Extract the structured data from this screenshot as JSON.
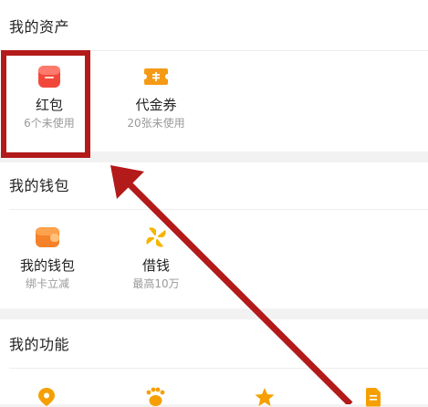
{
  "assets": {
    "title": "我的资产",
    "items": [
      {
        "icon": "red-packet-icon",
        "label": "红包",
        "sub": "6个未使用"
      },
      {
        "icon": "voucher-icon",
        "label": "代金券",
        "sub": "20张未使用"
      }
    ]
  },
  "wallet": {
    "title": "我的钱包",
    "items": [
      {
        "icon": "wallet-icon",
        "label": "我的钱包",
        "sub": "绑卡立减"
      },
      {
        "icon": "pinwheel-icon",
        "label": "借钱",
        "sub": "最高10万"
      }
    ]
  },
  "functions": {
    "title": "我的功能",
    "icons": [
      "location-icon",
      "paw-icon",
      "star-icon",
      "document-icon"
    ]
  },
  "colors": {
    "accent_orange": "#f5a000",
    "red_packet": "#f2483c",
    "annotation_red": "#b31a1a"
  }
}
